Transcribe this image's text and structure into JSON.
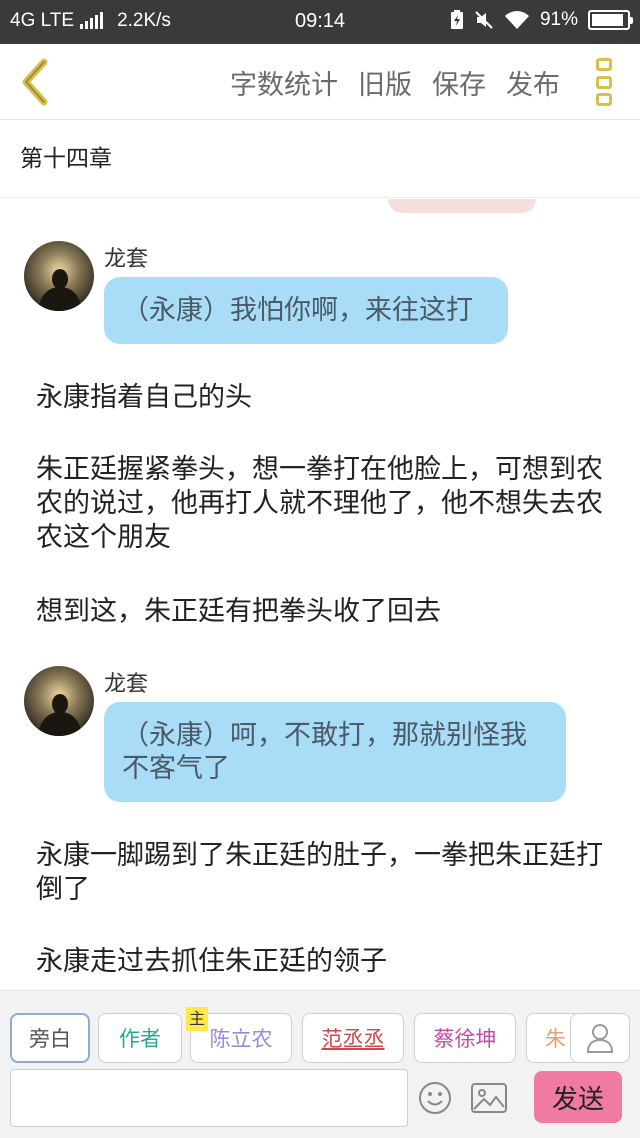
{
  "status_bar": {
    "network": "4G LTE",
    "speed": "2.2K/s",
    "time": "09:14",
    "battery_percent": "91%",
    "battery_level": 0.91,
    "icons": [
      "signal-bars-icon",
      "battery-charging-icon",
      "mute-icon",
      "wifi-icon",
      "battery-icon"
    ]
  },
  "top_bar": {
    "back_icon": "chevron-left-icon",
    "actions": [
      "字数统计",
      "旧版",
      "保存",
      "发布"
    ],
    "menu_icon": "more-vertical-icon",
    "accent_color": "#d8c04a"
  },
  "chapter": {
    "title": "第十四章"
  },
  "messages": [
    {
      "speaker": "龙套",
      "text": "（永康）我怕你啊，来往这打"
    },
    {
      "narration": "永康指着自己的头"
    },
    {
      "narration": "朱正廷握紧拳头，想一拳打在他脸上，可想到农农的说过，他再打人就不理他了，他不想失去农农这个朋友"
    },
    {
      "narration": "想到这，朱正廷有把拳头收了回去"
    },
    {
      "speaker": "龙套",
      "text": "（永康）呵，不敢打，那就别怪我不客气了"
    },
    {
      "narration": "永康一脚踢到了朱正廷的肚子，一拳把朱正廷打倒了"
    },
    {
      "narration": "永康走过去抓住朱正廷的领子"
    }
  ],
  "bubble_color": "#a9dcf6",
  "role_bar": {
    "roles": [
      {
        "label": "旁白",
        "color": "#555555"
      },
      {
        "label": "作者",
        "color": "#2aa88f"
      },
      {
        "label": "陈立农",
        "color": "#9a8ad8"
      },
      {
        "label": "范丞丞",
        "color": "#d04848"
      },
      {
        "label": "蔡徐坤",
        "color": "#c44aa8"
      },
      {
        "label": "朱",
        "color": "#e8a070"
      }
    ],
    "main_tag": "主",
    "person_icon": "person-icon"
  },
  "composer": {
    "input_value": "",
    "placeholder": "",
    "emoji_icon": "smiley-icon",
    "image_icon": "image-icon",
    "send_label": "发送",
    "send_color": "#f07aa0"
  }
}
